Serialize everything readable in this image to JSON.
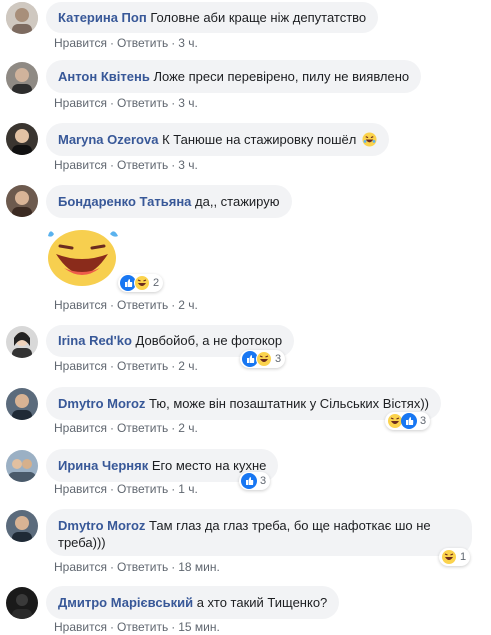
{
  "actions": {
    "like": "Нравится",
    "reply": "Ответить",
    "dot": "·"
  },
  "comments": [
    {
      "name": "Катерина Поп",
      "text": "Головне аби краще ніж депутатство",
      "time": "3 ч."
    },
    {
      "name": "Антон Квітень",
      "text": "Ложе преси перевірено, пилу не виявлено",
      "time": "3 ч."
    },
    {
      "name": "Maryna Ozerova",
      "text": "К Танюше на стажировку пошёл",
      "time": "3 ч."
    },
    {
      "name": "Бондаренко Татьяна",
      "text": "да,, стажирую",
      "time": "2 ч.",
      "reactions": "2"
    },
    {
      "name": "Irina Red'ko",
      "text": "Довбойоб, а не фотокор",
      "time": "2 ч.",
      "reactions": "3"
    },
    {
      "name": "Dmytro Moroz",
      "text": "Тю, може він позаштатник у Сільських Вістях))",
      "time": "2 ч.",
      "reactions": "3"
    },
    {
      "name": "Ирина Черняк",
      "text": "Его место на кухне",
      "time": "1 ч.",
      "reactions": "3"
    },
    {
      "name": "Dmytro Moroz",
      "text": "Там глаз да глаз треба, бо ще нафоткає шо не",
      "text2": "треба)))",
      "time": "18 мин.",
      "reactions": "1"
    },
    {
      "name": "Дмитро Марієвський",
      "text": "а хто такий Тищенко?",
      "time": "15 мин."
    }
  ]
}
